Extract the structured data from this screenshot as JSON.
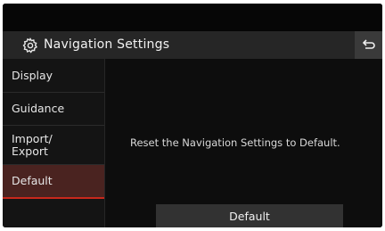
{
  "header": {
    "title": "Navigation Settings",
    "icon": "gear-icon",
    "back_icon": "back-icon"
  },
  "sidebar": {
    "items": [
      {
        "label": "Display"
      },
      {
        "label": "Guidance"
      },
      {
        "label": "Import/\nExport"
      },
      {
        "label": "Default",
        "selected": true
      }
    ]
  },
  "main": {
    "message": "Reset the Navigation Settings to Default.",
    "button_label": "Default"
  },
  "colors": {
    "selected_bg": "#4a2320",
    "selected_accent": "#c8281c"
  }
}
